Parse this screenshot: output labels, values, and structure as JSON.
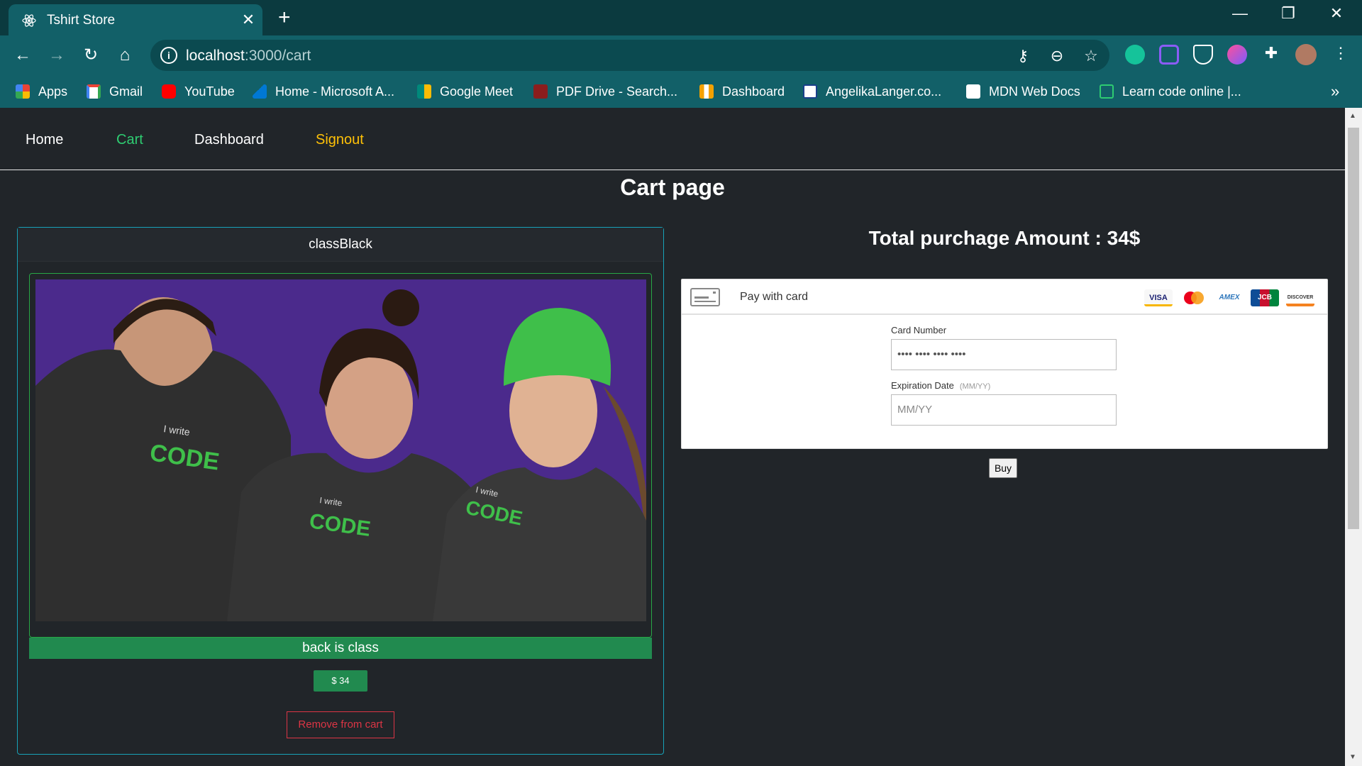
{
  "browser": {
    "tab_title": "Tshirt Store",
    "url_host": "localhost",
    "url_path": ":3000/cart",
    "bookmarks": [
      {
        "label": "Apps",
        "icon": "apps-grid-icon",
        "color": "#4285f4"
      },
      {
        "label": "Gmail",
        "icon": "gmail-icon",
        "color": "#ea4335"
      },
      {
        "label": "YouTube",
        "icon": "youtube-icon",
        "color": "#ff0000"
      },
      {
        "label": "Home - Microsoft A...",
        "icon": "azure-icon",
        "color": "#0078d4"
      },
      {
        "label": "Google Meet",
        "icon": "google-meet-icon",
        "color": "#00897b"
      },
      {
        "label": "PDF Drive - Search...",
        "icon": "pdf-drive-icon",
        "color": "#c62828"
      },
      {
        "label": "Dashboard",
        "icon": "dashboard-icon",
        "color": "#f4a100"
      },
      {
        "label": "AngelikaLanger.co...",
        "icon": "angelikalanger-icon",
        "color": "#ffffff"
      },
      {
        "label": "MDN Web Docs",
        "icon": "mdn-icon",
        "color": "#ffffff"
      },
      {
        "label": "Learn code online |...",
        "icon": "code-brackets-icon",
        "color": "#2ecc71"
      }
    ],
    "more_bookmarks": "»"
  },
  "nav": {
    "home": "Home",
    "cart": "Cart",
    "dashboard": "Dashboard",
    "signout": "Signout",
    "colors": {
      "default": "#ffffff",
      "active": "#2ecc71",
      "signout": "#ffc107"
    }
  },
  "page": {
    "title": "Cart page"
  },
  "cart_item": {
    "name": "classBlack",
    "description": "back is class",
    "price": "$ 34",
    "remove_label": "Remove from cart",
    "image_text": [
      "I write",
      "CODE",
      "I write",
      "CODE",
      "I write",
      "CODE"
    ]
  },
  "payment": {
    "total": "Total purchage Amount : 34$",
    "pay_title": "Pay with card",
    "card_logos": [
      "VISA",
      "mastercard",
      "AMEX",
      "JCB",
      "DISCOVER"
    ],
    "card_number_label": "Card Number",
    "card_number_value": "•••• •••• •••• ••••",
    "expiry_label": "Expiration Date",
    "expiry_hint": "(MM/YY)",
    "expiry_placeholder": "MM/YY",
    "buy_label": "Buy"
  }
}
